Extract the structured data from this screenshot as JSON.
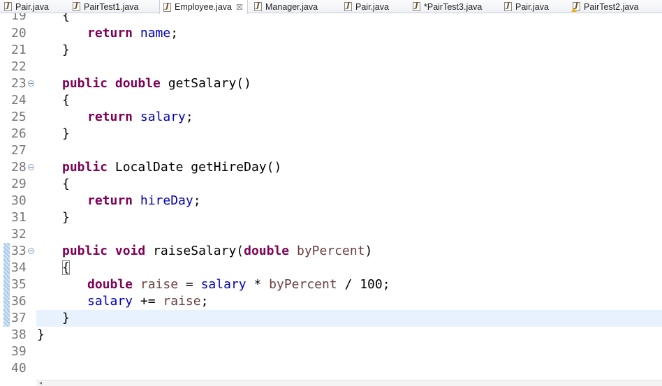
{
  "tabs": [
    {
      "label": "Pair.java",
      "active": false
    },
    {
      "label": "PairTest1.java",
      "active": false
    },
    {
      "label": "Employee.java",
      "active": true,
      "close": "☒"
    },
    {
      "label": "Manager.java",
      "active": false
    },
    {
      "label": "Pair.java",
      "active": false
    },
    {
      "label": "*PairTest3.java",
      "active": false
    },
    {
      "label": "Pair.java",
      "active": false
    },
    {
      "label": "PairTest2.java",
      "active": false,
      "warning": true
    }
  ],
  "editor": {
    "line_numbers": [
      "19",
      "20",
      "21",
      "22",
      "23",
      "24",
      "25",
      "26",
      "27",
      "28",
      "29",
      "30",
      "31",
      "32",
      "33",
      "34",
      "35",
      "36",
      "37",
      "38",
      "39",
      "40"
    ],
    "current_line": "37",
    "changed_lines": [
      "33",
      "34",
      "35",
      "36",
      "37"
    ],
    "folding_lines": [
      "23",
      "28",
      "33"
    ],
    "code": {
      "l19": "{",
      "l20": [
        "return",
        "name",
        ";"
      ],
      "l21": "}",
      "l23": [
        "public",
        "double",
        "getSalary()"
      ],
      "l24": "{",
      "l25": [
        "return",
        "salary",
        ";"
      ],
      "l26": "}",
      "l28": [
        "public",
        "LocalDate getHireDay()"
      ],
      "l29": "{",
      "l30": [
        "return",
        "hireDay",
        ";"
      ],
      "l31": "}",
      "l33": [
        "public",
        "void",
        "raiseSalary(",
        "double",
        "byPercent",
        ")"
      ],
      "l34": "{",
      "l35": [
        "double",
        "raise",
        "=",
        "salary",
        "*",
        "byPercent",
        "/ 100;"
      ],
      "l36": [
        "salary",
        "+=",
        "raise",
        ";"
      ],
      "l37": "}",
      "l38": "}"
    }
  },
  "scrollbar": {
    "left_arrow": "◂"
  }
}
